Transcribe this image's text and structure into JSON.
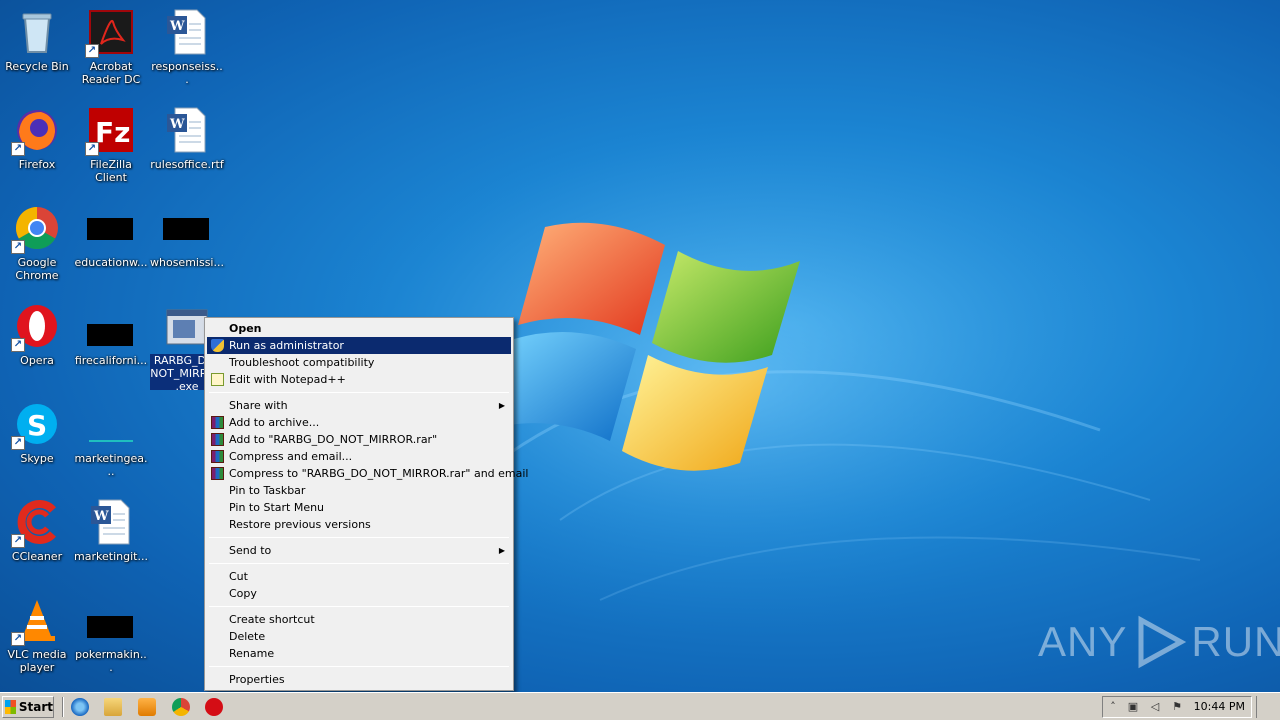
{
  "desktop": {
    "icons": [
      {
        "label": "Recycle Bin",
        "icon": "recycle-bin-icon"
      },
      {
        "label": "Acrobat Reader DC",
        "icon": "acrobat-icon"
      },
      {
        "label": "responseiss...",
        "icon": "word-document-icon"
      },
      {
        "label": "Firefox",
        "icon": "firefox-icon"
      },
      {
        "label": "FileZilla Client",
        "icon": "filezilla-icon"
      },
      {
        "label": "rulesoffice.rtf",
        "icon": "word-document-icon"
      },
      {
        "label": "Google Chrome",
        "icon": "chrome-icon"
      },
      {
        "label": "educationw...",
        "icon": "redacted-icon"
      },
      {
        "label": "whosemissi...",
        "icon": "redacted-icon"
      },
      {
        "label": "Opera",
        "icon": "opera-icon"
      },
      {
        "label": "firecaliforni...",
        "icon": "redacted-icon"
      },
      {
        "label": "RARBG_DO_NOT_MIRROR.exe",
        "icon": "executable-icon"
      },
      {
        "label": "Skype",
        "icon": "skype-icon"
      },
      {
        "label": "marketingea...",
        "icon": "redacted-icon"
      },
      {
        "label": "CCleaner",
        "icon": "ccleaner-icon"
      },
      {
        "label": "marketingit...",
        "icon": "word-document-icon"
      },
      {
        "label": "VLC media player",
        "icon": "vlc-icon"
      },
      {
        "label": "pokermakin...",
        "icon": "redacted-icon"
      }
    ]
  },
  "context_menu": {
    "groups": [
      [
        {
          "label": "Open",
          "bold": true
        },
        {
          "label": "Run as administrator",
          "icon": "uac-shield-icon",
          "highlighted": true
        },
        {
          "label": "Troubleshoot compatibility"
        },
        {
          "label": "Edit with Notepad++",
          "icon": "notepadpp-icon"
        }
      ],
      [
        {
          "label": "Share with",
          "submenu": true
        },
        {
          "label": "Add to archive...",
          "icon": "winrar-icon"
        },
        {
          "label": "Add to \"RARBG_DO_NOT_MIRROR.rar\"",
          "icon": "winrar-icon"
        },
        {
          "label": "Compress and email...",
          "icon": "winrar-icon"
        },
        {
          "label": "Compress to \"RARBG_DO_NOT_MIRROR.rar\" and email",
          "icon": "winrar-icon"
        },
        {
          "label": "Pin to Taskbar"
        },
        {
          "label": "Pin to Start Menu"
        },
        {
          "label": "Restore previous versions"
        }
      ],
      [
        {
          "label": "Send to",
          "submenu": true
        }
      ],
      [
        {
          "label": "Cut"
        },
        {
          "label": "Copy"
        }
      ],
      [
        {
          "label": "Create shortcut"
        },
        {
          "label": "Delete"
        },
        {
          "label": "Rename"
        }
      ],
      [
        {
          "label": "Properties"
        }
      ]
    ]
  },
  "taskbar": {
    "start_label": "Start",
    "quick_launch": [
      "ie-icon",
      "explorer-icon",
      "media-player-icon",
      "chrome-icon",
      "opera-icon"
    ],
    "clock": "10:44 PM"
  },
  "watermark": {
    "left": "ANY",
    "right": "RUN"
  },
  "colors": {
    "menu_highlight": "#0b2a6f",
    "selection": "#0b2f7a",
    "taskbar": "#d4d0c8"
  }
}
